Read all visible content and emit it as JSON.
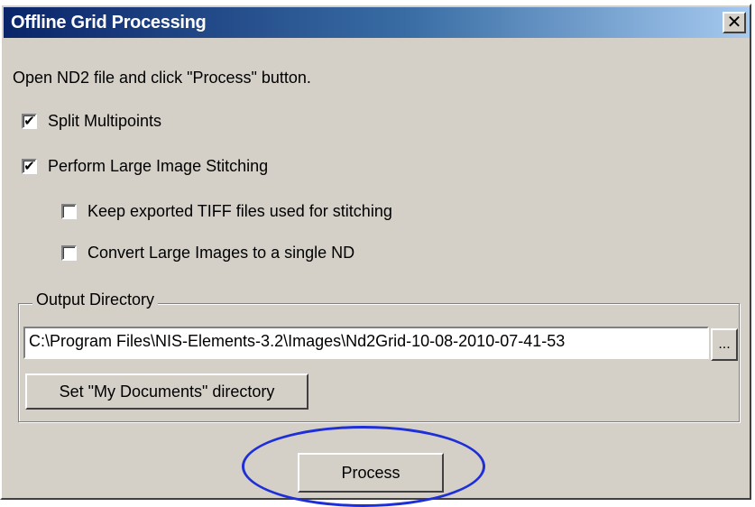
{
  "window": {
    "title": "Offline Grid Processing",
    "close_glyph": "✕"
  },
  "instruction": "Open ND2 file and click \"Process\" button.",
  "options": [
    {
      "label": "Split Multipoints",
      "checked": true
    },
    {
      "label": "Perform Large Image Stitching",
      "checked": true
    },
    {
      "label": "Keep exported TIFF files used for stitching",
      "checked": false
    },
    {
      "label": "Convert Large Images to a single ND",
      "checked": false
    }
  ],
  "output": {
    "group_label": "Output Directory",
    "path": "C:\\Program Files\\NIS-Elements-3.2\\Images\\Nd2Grid-10-08-2010-07-41-53",
    "browse_label": "...",
    "mydocs_label": "Set \"My Documents\" directory"
  },
  "process_label": "Process",
  "icons": {
    "check": "✔",
    "close": "close-icon"
  },
  "colors": {
    "face": "#d4d0c8",
    "title_start": "#0a246a",
    "title_end": "#a6caf0",
    "highlight_ellipse": "#1f2fd8"
  }
}
